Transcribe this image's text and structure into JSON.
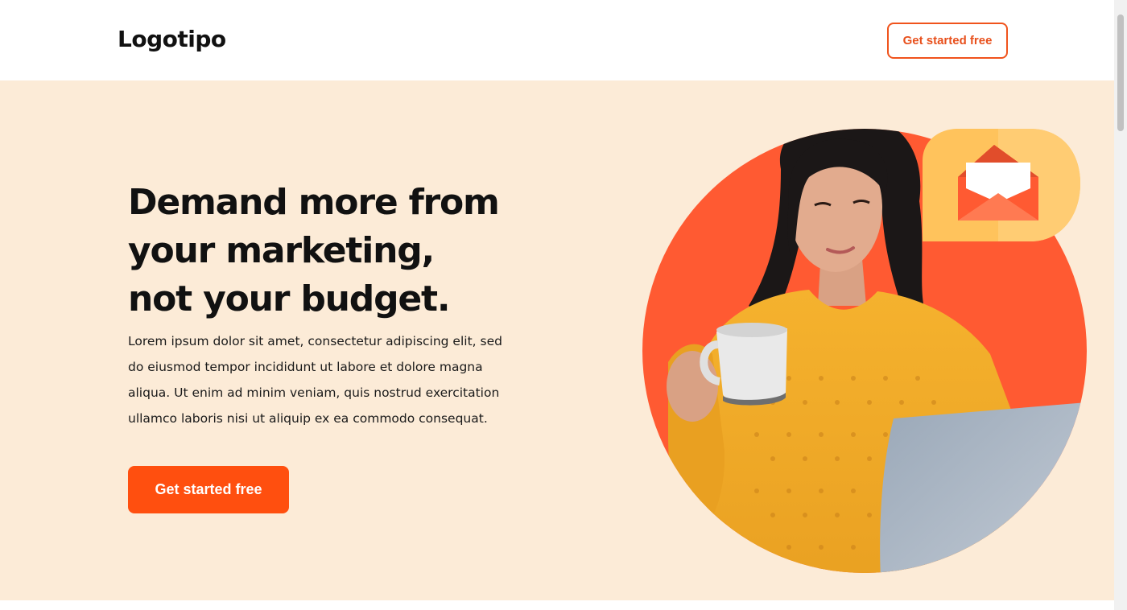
{
  "header": {
    "logo": "Logotipo",
    "cta_label": "Get started free"
  },
  "hero": {
    "title": "Demand more from your marketing, not your budget.",
    "body": "Lorem ipsum dolor sit amet, consectetur adipiscing elit, sed do eiusmod tempor incididunt ut labore et dolore magna aliqua. Ut enim ad minim veniam, quis nostrud exercitation ullamco laboris nisi ut aliquip ex ea commodo consequat.",
    "cta_label": "Get started free"
  },
  "colors": {
    "accent": "#ff4f0f",
    "hero_background": "#fcebd7",
    "circle": "#ff5a32",
    "badge": "#ffc35c"
  },
  "icons": {
    "badge": "envelope-icon"
  }
}
